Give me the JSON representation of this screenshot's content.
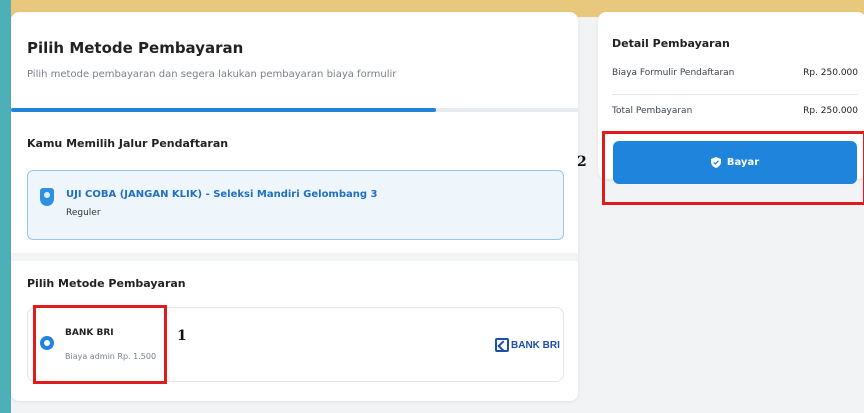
{
  "page": {
    "title": "Pilih Metode Pembayaran",
    "subtitle": "Pilih metode pembayaran dan segera lakukan pembayaran biaya formulir",
    "progress_percent": 75
  },
  "registration_path": {
    "heading": "Kamu Memilih Jalur Pendaftaran",
    "title": "UJI COBA (JANGAN KLIK) - Seleksi Mandiri Gelombang 3",
    "type": "Reguler"
  },
  "payment_methods": {
    "heading": "Pilih Metode Pembayaran",
    "items": [
      {
        "name": "BANK BRI",
        "fee": "Biaya admin Rp. 1.500",
        "logo_text": "BANK BRI",
        "selected": true
      }
    ]
  },
  "payment_detail": {
    "heading": "Detail Pembayaran",
    "rows": [
      {
        "label": "Biaya Formulir Pendaftaran",
        "value": "Rp. 250.000"
      },
      {
        "label": "Total Pembayaran",
        "value": "Rp. 250.000"
      }
    ],
    "pay_button_label": "Bayar"
  },
  "annotations": [
    "1",
    "2"
  ],
  "colors": {
    "accent": "#1f84dc",
    "highlight": "#e01b1b",
    "top_strip": "#e7c87c",
    "left_strip": "#4db0b8"
  }
}
